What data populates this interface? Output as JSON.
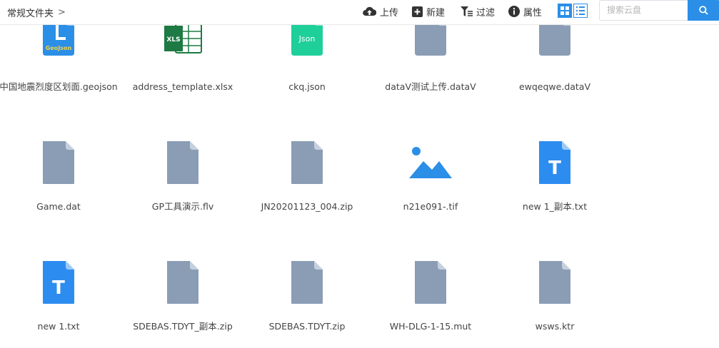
{
  "breadcrumb": {
    "label": "常规文件夹",
    "chevron": ">"
  },
  "toolbar": {
    "upload": "上传",
    "new": "新建",
    "filter": "过滤",
    "properties": "属性"
  },
  "search": {
    "placeholder": "搜索云盘"
  },
  "colors": {
    "accent": "#2b8ee7",
    "generic_file": "#8a9db5",
    "json": "#1fcf9a",
    "xls": "#1d7a44",
    "text": "#2d8cf0"
  },
  "files": [
    {
      "name": "中国地震烈度区划面.geojson",
      "icon": "geojson-icon"
    },
    {
      "name": "address_template.xlsx",
      "icon": "xls-icon"
    },
    {
      "name": "ckq.json",
      "icon": "json-icon"
    },
    {
      "name": "dataV测试上传.dataV",
      "icon": "generic-file-icon"
    },
    {
      "name": "ewqeqwe.dataV",
      "icon": "generic-file-icon"
    },
    {
      "name": "Game.dat",
      "icon": "generic-file-icon"
    },
    {
      "name": "GP工具演示.flv",
      "icon": "generic-file-icon"
    },
    {
      "name": "JN20201123_004.zip",
      "icon": "generic-file-icon"
    },
    {
      "name": "n21e091-.tif",
      "icon": "image-icon"
    },
    {
      "name": "new 1_副本.txt",
      "icon": "text-file-icon"
    },
    {
      "name": "new 1.txt",
      "icon": "text-file-icon"
    },
    {
      "name": "SDEBAS.TDYT_副本.zip",
      "icon": "generic-file-icon"
    },
    {
      "name": "SDEBAS.TDYT.zip",
      "icon": "generic-file-icon"
    },
    {
      "name": "WH-DLG-1-15.mut",
      "icon": "generic-file-icon"
    },
    {
      "name": "wsws.ktr",
      "icon": "generic-file-icon"
    }
  ],
  "icon_labels": {
    "geojson": "GeoJson",
    "xls": "XLS",
    "json": "Json",
    "text": "T"
  }
}
